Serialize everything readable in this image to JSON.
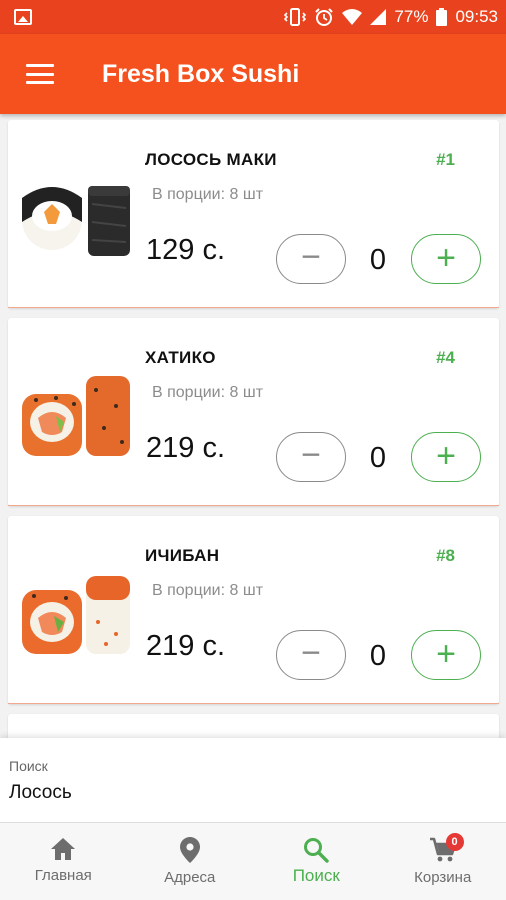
{
  "status_bar": {
    "battery": "77%",
    "time": "09:53"
  },
  "app_bar": {
    "title": "Fresh Box Sushi"
  },
  "products": [
    {
      "name": "ЛОСОСЬ МАКИ",
      "number": "#1",
      "portion": "В порции: 8 шт",
      "price": "129 с.",
      "quantity": "0",
      "minus_label": "−",
      "plus_label": "+"
    },
    {
      "name": "ХАТИКО",
      "number": "#4",
      "portion": "В порции: 8 шт",
      "price": "219 с.",
      "quantity": "0",
      "minus_label": "−",
      "plus_label": "+"
    },
    {
      "name": "ИЧИБАН",
      "number": "#8",
      "portion": "В порции: 8 шт",
      "price": "219 с.",
      "quantity": "0",
      "minus_label": "−",
      "plus_label": "+"
    }
  ],
  "search": {
    "label": "Поиск",
    "value": "Лосось"
  },
  "bottom_nav": {
    "items": [
      {
        "label": "Главная",
        "icon": "home-icon"
      },
      {
        "label": "Адреса",
        "icon": "location-pin-icon"
      },
      {
        "label": "Поиск",
        "icon": "search-icon",
        "active": true
      },
      {
        "label": "Корзина",
        "icon": "cart-icon"
      }
    ],
    "cart_badge": "0"
  },
  "colors": {
    "accent": "#f4511e",
    "status_bar": "#e8431e",
    "active": "#4caf50",
    "badge": "#e53935"
  }
}
